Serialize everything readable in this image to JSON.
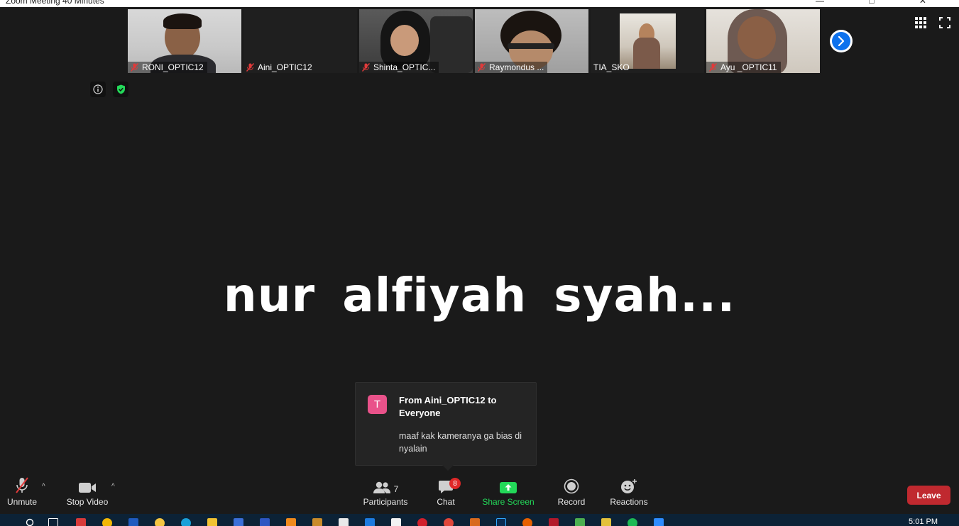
{
  "window": {
    "title": "Zoom Meeting 40 Minutes",
    "controls": "— □ ✕"
  },
  "participants_strip": [
    {
      "name": "RONI_OPTIC12",
      "muted": true,
      "video": true
    },
    {
      "name": "Aini_OPTIC12",
      "muted": true,
      "video": false
    },
    {
      "name": "Shinta_OPTIC...",
      "muted": true,
      "video": true
    },
    {
      "name": "Raymondus ...",
      "muted": true,
      "video": true
    },
    {
      "name": "TIA_SKO",
      "muted": false,
      "video": true
    },
    {
      "name": "Ayu _OPTIC11",
      "muted": true,
      "video": true
    }
  ],
  "active_speaker": {
    "name": "nur alfiyah syah..."
  },
  "chat_notification": {
    "avatar_letter": "T",
    "from": "From Aini_OPTIC12 to Everyone",
    "message": "maaf kak kameranya ga bias di nyalain"
  },
  "toolbar": {
    "unmute": "Unmute",
    "stop_video": "Stop Video",
    "participants": "Participants",
    "participant_count": "7",
    "chat": "Chat",
    "chat_unread": "8",
    "share_screen": "Share Screen",
    "record": "Record",
    "reactions": "Reactions",
    "leave": "Leave"
  },
  "taskbar": {
    "clock": "5:01 PM"
  },
  "colors": {
    "background": "#1a1a1a",
    "share_green": "#23d959",
    "leave_red": "#c0292f",
    "badge_red": "#e02828",
    "avatar_pink": "#e9528a",
    "zoom_blue": "#0e72ed"
  }
}
